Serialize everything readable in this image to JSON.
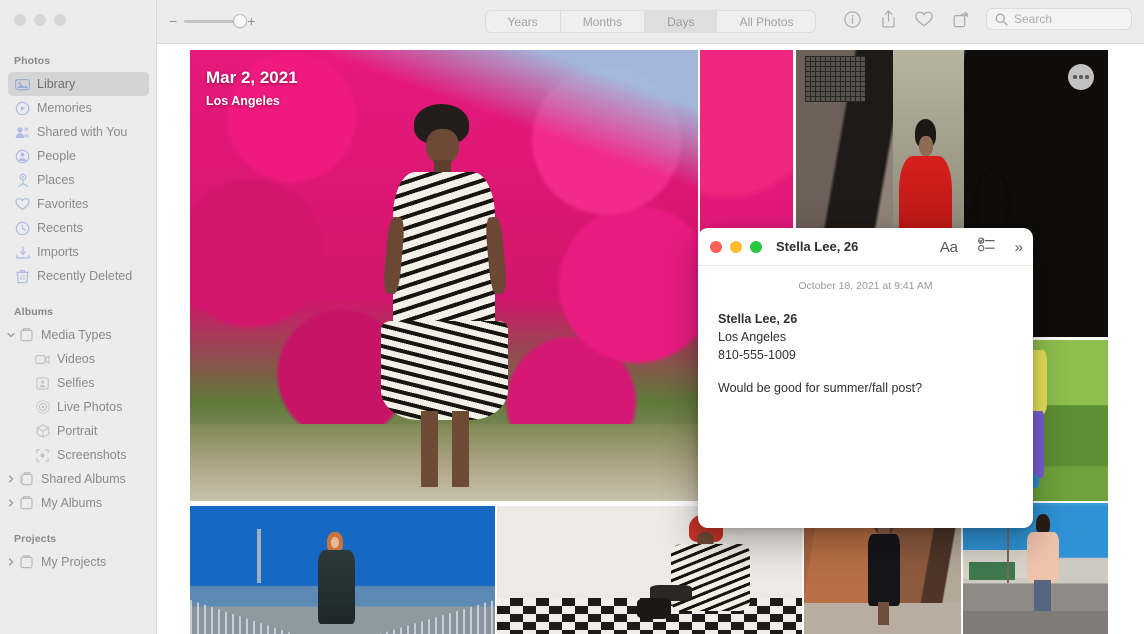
{
  "window": {
    "traffic_lights": [
      "close",
      "minimize",
      "zoom"
    ]
  },
  "sidebar": {
    "sections": [
      {
        "title": "Photos",
        "items": [
          {
            "label": "Library",
            "icon": "library-icon",
            "selected": true
          },
          {
            "label": "Memories",
            "icon": "memories-icon",
            "selected": false
          },
          {
            "label": "Shared with You",
            "icon": "shared-with-you-icon",
            "selected": false
          },
          {
            "label": "People",
            "icon": "people-icon",
            "selected": false
          },
          {
            "label": "Places",
            "icon": "places-icon",
            "selected": false
          },
          {
            "label": "Favorites",
            "icon": "heart-icon",
            "selected": false
          },
          {
            "label": "Recents",
            "icon": "clock-icon",
            "selected": false
          },
          {
            "label": "Imports",
            "icon": "import-icon",
            "selected": false
          },
          {
            "label": "Recently Deleted",
            "icon": "trash-icon",
            "selected": false
          }
        ]
      },
      {
        "title": "Albums",
        "items": [
          {
            "label": "Media Types",
            "icon": "folder-icon",
            "disclosure": "expanded"
          },
          {
            "label": "Videos",
            "icon": "video-icon",
            "indent": true
          },
          {
            "label": "Selfies",
            "icon": "selfie-icon",
            "indent": true
          },
          {
            "label": "Live Photos",
            "icon": "live-photo-icon",
            "indent": true
          },
          {
            "label": "Portrait",
            "icon": "portrait-icon",
            "indent": true
          },
          {
            "label": "Screenshots",
            "icon": "screenshot-icon",
            "indent": true
          },
          {
            "label": "Shared Albums",
            "icon": "shared-folder-icon",
            "disclosure": "collapsed"
          },
          {
            "label": "My Albums",
            "icon": "folder-icon",
            "disclosure": "collapsed"
          }
        ]
      },
      {
        "title": "Projects",
        "items": [
          {
            "label": "My Projects",
            "icon": "folder-icon",
            "disclosure": "collapsed"
          }
        ]
      }
    ]
  },
  "toolbar": {
    "zoom_out_label": "−",
    "zoom_in_label": "+",
    "segments": [
      {
        "label": "Years",
        "active": false
      },
      {
        "label": "Months",
        "active": false
      },
      {
        "label": "Days",
        "active": true
      },
      {
        "label": "All Photos",
        "active": false
      }
    ],
    "icons": [
      "info-icon",
      "share-icon",
      "favorite-icon",
      "rotate-icon"
    ],
    "search": {
      "placeholder": "Search",
      "value": ""
    }
  },
  "grid": {
    "hero": {
      "date": "Mar 2, 2021",
      "location": "Los Angeles"
    },
    "more_button": "more-options-button"
  },
  "notes": {
    "title": "Stella Lee, 26",
    "toolbar": {
      "format_label": "Aa",
      "checklist_icon": "checklist-icon",
      "expand_label": "»"
    },
    "date": "October 18, 2021 at 9:41 AM",
    "body": [
      {
        "text": "Stella Lee, 26",
        "bold": true
      },
      {
        "text": "Los Angeles",
        "bold": false
      },
      {
        "text": "810-555-1009",
        "bold": false
      },
      {
        "text": "",
        "bold": false
      },
      {
        "text": "Would be good for summer/fall post?",
        "bold": false
      }
    ],
    "traffic_light_colors": {
      "close": "#FF5F57",
      "minimize": "#FEBC2E",
      "zoom": "#28C840"
    }
  }
}
